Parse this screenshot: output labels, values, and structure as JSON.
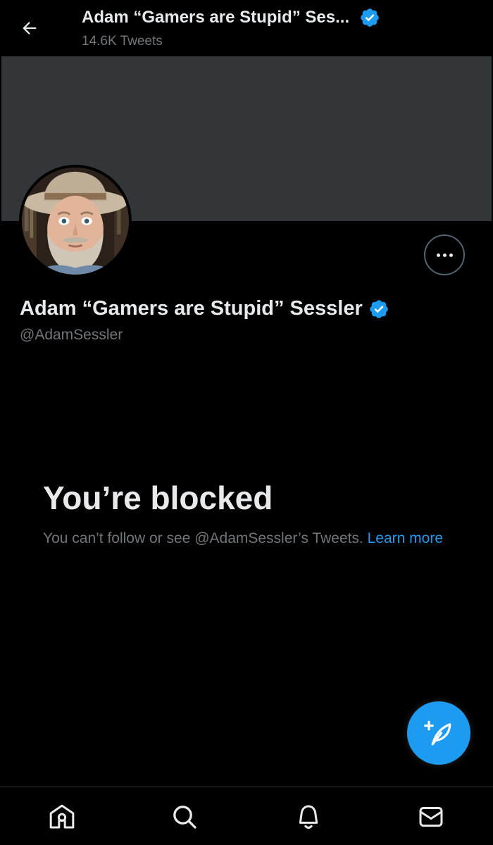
{
  "header": {
    "title": "Adam “Gamers are Stupid” Ses...",
    "tweet_count": "14.6K Tweets"
  },
  "profile": {
    "name": "Adam “Gamers are Stupid” Sessler",
    "handle": "@AdamSessler",
    "verified": true
  },
  "blocked": {
    "title": "You’re blocked",
    "description": "You can’t follow or see @AdamSessler’s Tweets.",
    "learn_more": "Learn more"
  },
  "colors": {
    "accent": "#1d9bf0",
    "background": "#000000",
    "banner": "#333639",
    "secondary_text": "#71767b"
  },
  "icons": {
    "back": "arrow-left-icon",
    "verified": "verified-badge-icon",
    "more": "more-dots-icon",
    "compose": "compose-feather-icon",
    "nav": [
      "home-icon",
      "search-icon",
      "notifications-bell-icon",
      "messages-mail-icon"
    ]
  }
}
